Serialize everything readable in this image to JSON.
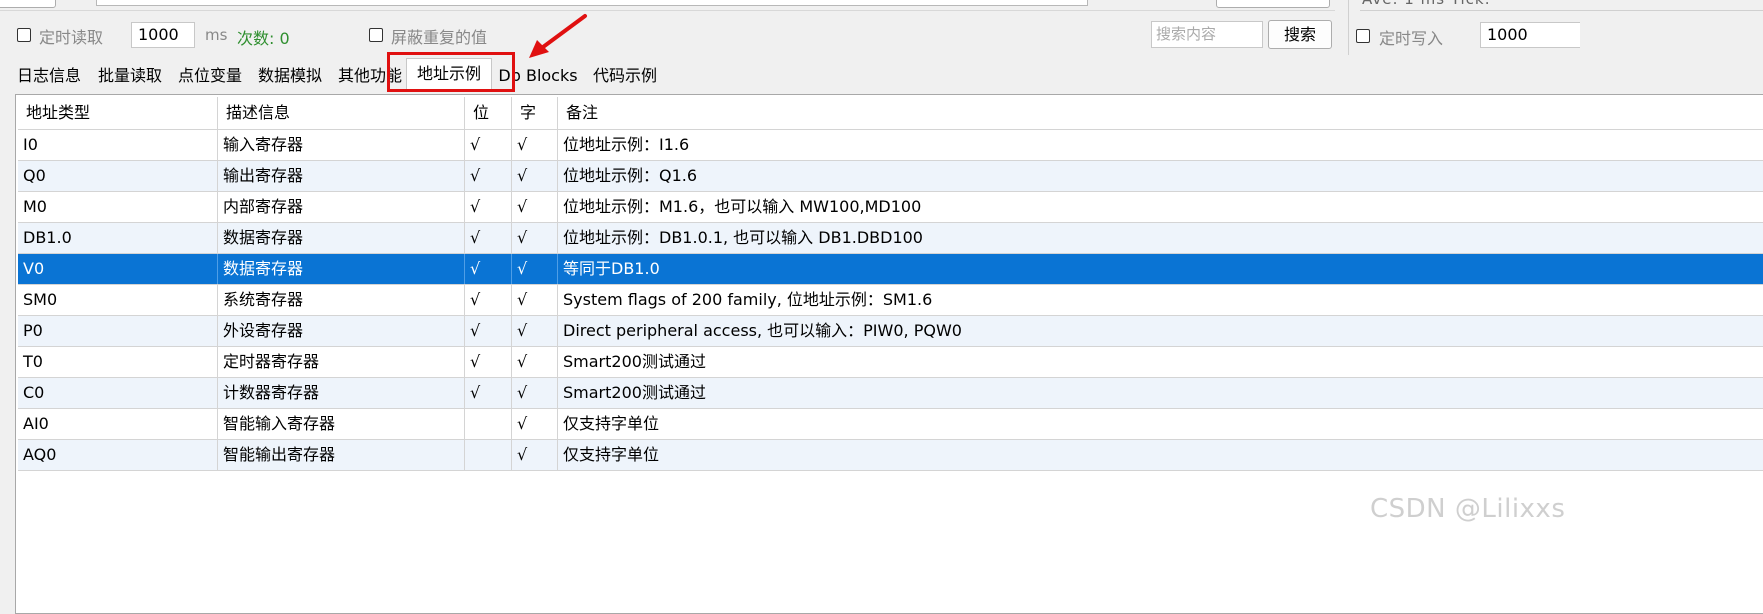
{
  "top": {
    "stats": "Ave:   1 ms      Tick:"
  },
  "toolbar": {
    "timed_read_label": "定时读取",
    "interval_value": "1000",
    "ms_label": "ms",
    "count_label": "次数: 0",
    "mask_dup_label": "屏蔽重复的值",
    "search_placeholder": "搜索内容",
    "search_button": "搜索",
    "timed_write_label": "定时写入",
    "write_interval_value": "1000"
  },
  "tabs": [
    {
      "label": "日志信息"
    },
    {
      "label": "批量读取"
    },
    {
      "label": "点位变量"
    },
    {
      "label": "数据模拟"
    },
    {
      "label": "其他功能"
    },
    {
      "label": "地址示例"
    },
    {
      "label": "Db Blocks"
    },
    {
      "label": "代码示例"
    }
  ],
  "active_tab": "地址示例",
  "colors": {
    "selection": "#0a74d4",
    "highlight_box": "#e01010",
    "count_green": "#2f8f2f"
  },
  "table": {
    "columns": [
      "地址类型",
      "描述信息",
      "位",
      "字",
      "备注"
    ],
    "rows": [
      {
        "type": "I0",
        "desc": "输入寄存器",
        "bit": "√",
        "word": "√",
        "note": "位地址示例：I1.6"
      },
      {
        "type": "Q0",
        "desc": "输出寄存器",
        "bit": "√",
        "word": "√",
        "note": "位地址示例：Q1.6"
      },
      {
        "type": "M0",
        "desc": "内部寄存器",
        "bit": "√",
        "word": "√",
        "note": "位地址示例：M1.6，也可以输入 MW100,MD100"
      },
      {
        "type": "DB1.0",
        "desc": "数据寄存器",
        "bit": "√",
        "word": "√",
        "note": "位地址示例：DB1.0.1, 也可以输入 DB1.DBD100"
      },
      {
        "type": "V0",
        "desc": "数据寄存器",
        "bit": "√",
        "word": "√",
        "note": "等同于DB1.0"
      },
      {
        "type": "SM0",
        "desc": "系统寄存器",
        "bit": "√",
        "word": "√",
        "note": "System flags of 200 family, 位地址示例：SM1.6"
      },
      {
        "type": "P0",
        "desc": "外设寄存器",
        "bit": "√",
        "word": "√",
        "note": "Direct peripheral access, 也可以输入：PIW0, PQW0"
      },
      {
        "type": "T0",
        "desc": "定时器寄存器",
        "bit": "√",
        "word": "√",
        "note": "Smart200测试通过"
      },
      {
        "type": "C0",
        "desc": "计数器寄存器",
        "bit": "√",
        "word": "√",
        "note": "Smart200测试通过"
      },
      {
        "type": "AI0",
        "desc": "智能输入寄存器",
        "bit": "",
        "word": "√",
        "note": "仅支持字单位"
      },
      {
        "type": "AQ0",
        "desc": "智能输出寄存器",
        "bit": "",
        "word": "√",
        "note": "仅支持字单位"
      }
    ],
    "selected_row": 4
  },
  "watermark": "CSDN @Lilixxs"
}
